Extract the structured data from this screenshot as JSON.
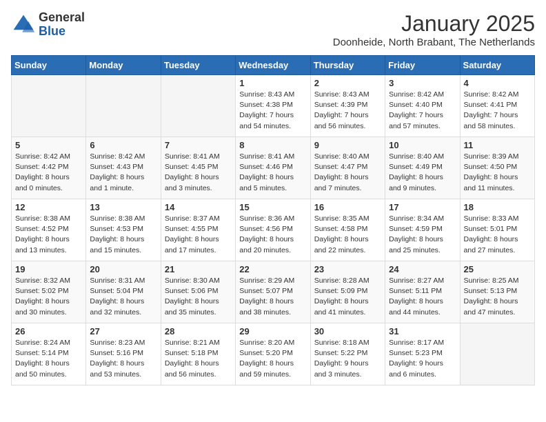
{
  "logo": {
    "general": "General",
    "blue": "Blue"
  },
  "header": {
    "month": "January 2025",
    "location": "Doonheide, North Brabant, The Netherlands"
  },
  "days_of_week": [
    "Sunday",
    "Monday",
    "Tuesday",
    "Wednesday",
    "Thursday",
    "Friday",
    "Saturday"
  ],
  "weeks": [
    [
      {
        "day": "",
        "info": ""
      },
      {
        "day": "",
        "info": ""
      },
      {
        "day": "",
        "info": ""
      },
      {
        "day": "1",
        "info": "Sunrise: 8:43 AM\nSunset: 4:38 PM\nDaylight: 7 hours\nand 54 minutes."
      },
      {
        "day": "2",
        "info": "Sunrise: 8:43 AM\nSunset: 4:39 PM\nDaylight: 7 hours\nand 56 minutes."
      },
      {
        "day": "3",
        "info": "Sunrise: 8:42 AM\nSunset: 4:40 PM\nDaylight: 7 hours\nand 57 minutes."
      },
      {
        "day": "4",
        "info": "Sunrise: 8:42 AM\nSunset: 4:41 PM\nDaylight: 7 hours\nand 58 minutes."
      }
    ],
    [
      {
        "day": "5",
        "info": "Sunrise: 8:42 AM\nSunset: 4:42 PM\nDaylight: 8 hours\nand 0 minutes."
      },
      {
        "day": "6",
        "info": "Sunrise: 8:42 AM\nSunset: 4:43 PM\nDaylight: 8 hours\nand 1 minute."
      },
      {
        "day": "7",
        "info": "Sunrise: 8:41 AM\nSunset: 4:45 PM\nDaylight: 8 hours\nand 3 minutes."
      },
      {
        "day": "8",
        "info": "Sunrise: 8:41 AM\nSunset: 4:46 PM\nDaylight: 8 hours\nand 5 minutes."
      },
      {
        "day": "9",
        "info": "Sunrise: 8:40 AM\nSunset: 4:47 PM\nDaylight: 8 hours\nand 7 minutes."
      },
      {
        "day": "10",
        "info": "Sunrise: 8:40 AM\nSunset: 4:49 PM\nDaylight: 8 hours\nand 9 minutes."
      },
      {
        "day": "11",
        "info": "Sunrise: 8:39 AM\nSunset: 4:50 PM\nDaylight: 8 hours\nand 11 minutes."
      }
    ],
    [
      {
        "day": "12",
        "info": "Sunrise: 8:38 AM\nSunset: 4:52 PM\nDaylight: 8 hours\nand 13 minutes."
      },
      {
        "day": "13",
        "info": "Sunrise: 8:38 AM\nSunset: 4:53 PM\nDaylight: 8 hours\nand 15 minutes."
      },
      {
        "day": "14",
        "info": "Sunrise: 8:37 AM\nSunset: 4:55 PM\nDaylight: 8 hours\nand 17 minutes."
      },
      {
        "day": "15",
        "info": "Sunrise: 8:36 AM\nSunset: 4:56 PM\nDaylight: 8 hours\nand 20 minutes."
      },
      {
        "day": "16",
        "info": "Sunrise: 8:35 AM\nSunset: 4:58 PM\nDaylight: 8 hours\nand 22 minutes."
      },
      {
        "day": "17",
        "info": "Sunrise: 8:34 AM\nSunset: 4:59 PM\nDaylight: 8 hours\nand 25 minutes."
      },
      {
        "day": "18",
        "info": "Sunrise: 8:33 AM\nSunset: 5:01 PM\nDaylight: 8 hours\nand 27 minutes."
      }
    ],
    [
      {
        "day": "19",
        "info": "Sunrise: 8:32 AM\nSunset: 5:02 PM\nDaylight: 8 hours\nand 30 minutes."
      },
      {
        "day": "20",
        "info": "Sunrise: 8:31 AM\nSunset: 5:04 PM\nDaylight: 8 hours\nand 32 minutes."
      },
      {
        "day": "21",
        "info": "Sunrise: 8:30 AM\nSunset: 5:06 PM\nDaylight: 8 hours\nand 35 minutes."
      },
      {
        "day": "22",
        "info": "Sunrise: 8:29 AM\nSunset: 5:07 PM\nDaylight: 8 hours\nand 38 minutes."
      },
      {
        "day": "23",
        "info": "Sunrise: 8:28 AM\nSunset: 5:09 PM\nDaylight: 8 hours\nand 41 minutes."
      },
      {
        "day": "24",
        "info": "Sunrise: 8:27 AM\nSunset: 5:11 PM\nDaylight: 8 hours\nand 44 minutes."
      },
      {
        "day": "25",
        "info": "Sunrise: 8:25 AM\nSunset: 5:13 PM\nDaylight: 8 hours\nand 47 minutes."
      }
    ],
    [
      {
        "day": "26",
        "info": "Sunrise: 8:24 AM\nSunset: 5:14 PM\nDaylight: 8 hours\nand 50 minutes."
      },
      {
        "day": "27",
        "info": "Sunrise: 8:23 AM\nSunset: 5:16 PM\nDaylight: 8 hours\nand 53 minutes."
      },
      {
        "day": "28",
        "info": "Sunrise: 8:21 AM\nSunset: 5:18 PM\nDaylight: 8 hours\nand 56 minutes."
      },
      {
        "day": "29",
        "info": "Sunrise: 8:20 AM\nSunset: 5:20 PM\nDaylight: 8 hours\nand 59 minutes."
      },
      {
        "day": "30",
        "info": "Sunrise: 8:18 AM\nSunset: 5:22 PM\nDaylight: 9 hours\nand 3 minutes."
      },
      {
        "day": "31",
        "info": "Sunrise: 8:17 AM\nSunset: 5:23 PM\nDaylight: 9 hours\nand 6 minutes."
      },
      {
        "day": "",
        "info": ""
      }
    ]
  ]
}
